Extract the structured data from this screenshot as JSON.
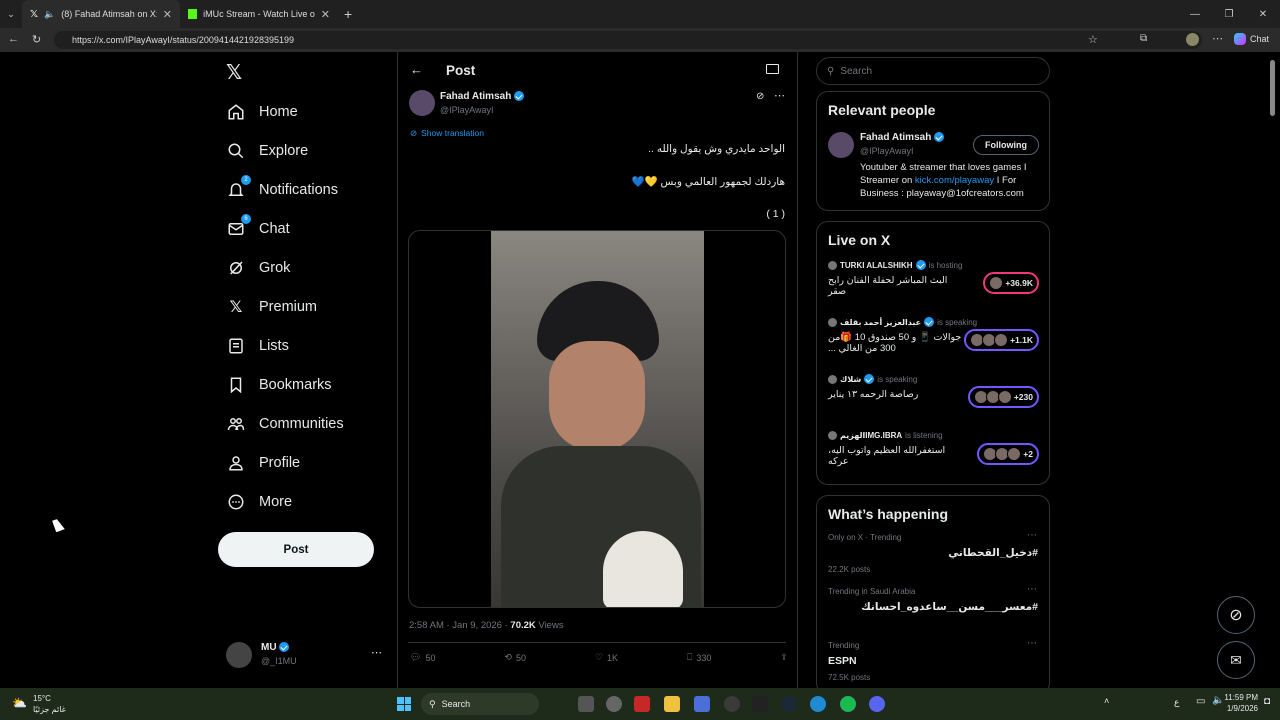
{
  "browser": {
    "tabs": [
      {
        "title": "(8) Fahad Atimsah on X: '( 1 )",
        "active": true
      },
      {
        "title": "iMUc Stream - Watch Live on Kick",
        "active": false
      }
    ],
    "url": "https://x.com/IPlayAwayI/status/2009414421928395199"
  },
  "nav": {
    "items": [
      {
        "label": "Home",
        "icon": "home-icon"
      },
      {
        "label": "Explore",
        "icon": "search-icon"
      },
      {
        "label": "Notifications",
        "icon": "bell-icon",
        "badge": "2"
      },
      {
        "label": "Chat",
        "icon": "mail-icon",
        "badge": "6"
      },
      {
        "label": "Grok",
        "icon": "grok-icon"
      },
      {
        "label": "Premium",
        "icon": "x-logo-icon"
      },
      {
        "label": "Lists",
        "icon": "list-icon"
      },
      {
        "label": "Bookmarks",
        "icon": "bookmark-icon"
      },
      {
        "label": "Communities",
        "icon": "people-icon"
      },
      {
        "label": "Profile",
        "icon": "person-icon"
      },
      {
        "label": "More",
        "icon": "more-circle-icon"
      }
    ],
    "post_label": "Post",
    "account": {
      "name": "MU",
      "handle": "@_I1MU"
    }
  },
  "post": {
    "header": "Post",
    "author": {
      "name": "Fahad Atimsah",
      "handle": "@IPlayAwayI"
    },
    "show_translation": "Show translation",
    "line1": "الواحد مايدري وش يقول والله ..",
    "line2": "هاردلك لجمهور العالمي وبس 💛💙",
    "line3": "( 1 )",
    "timestamp": "2:58 AM · Jan 9, 2026 · ",
    "views_count": "70.2K",
    "views_label": " Views",
    "replies": "50",
    "reposts": "50",
    "likes": "1K",
    "bookmarks": "330"
  },
  "right": {
    "search_placeholder": "Search",
    "relevant_title": "Relevant people",
    "person": {
      "name": "Fahad Atimsah",
      "handle": "@IPlayAwayI",
      "button": "Following",
      "bio_pre": "Youtuber & streamer that loves games I Streamer on ",
      "bio_link": "kick.com/playaway",
      "bio_post": " I For Business : playaway@1ofcreators.com"
    },
    "live_title": "Live on X",
    "live": [
      {
        "host": "TURKI ALALSHIKH",
        "status": "is hosting",
        "title": "البث المباشر لحفلة الفنان رابح صقر",
        "count": "+36.9K"
      },
      {
        "host": "عبدالعزيز أحمد بقلف",
        "status": "is speaking",
        "title": "جوالات 📱 و 50 صندوق 10 🎁من 300 من  الغالي ...",
        "count": "+1.1K"
      },
      {
        "host": "شلاك",
        "status": "is speaking",
        "title": "رصاصة الرحمه ١٣ يناير",
        "count": "+230"
      },
      {
        "host": "الهزيمIMG.IBRA",
        "status": "is listening",
        "title": "استغفرالله العظيم واتوب اليه، عركه",
        "count": "+2"
      }
    ],
    "happening_title": "What’s happening",
    "trends": [
      {
        "category": "Only on X · Trending",
        "name": "#دخيل_القحطاني",
        "count": "22.2K posts"
      },
      {
        "category": "Trending in Saudi Arabia",
        "name": "#معسر___مسن__ساعدوه_احسانك",
        "count": ""
      },
      {
        "category": "Trending",
        "name": "ESPN",
        "count": "72.5K posts"
      }
    ]
  },
  "taskbar": {
    "weather_temp": "15°C",
    "weather_desc": "غائم جزئيًا",
    "search_label": "Search",
    "time": "11:59 PM",
    "date": "1/9/2026",
    "lang": "ع"
  }
}
